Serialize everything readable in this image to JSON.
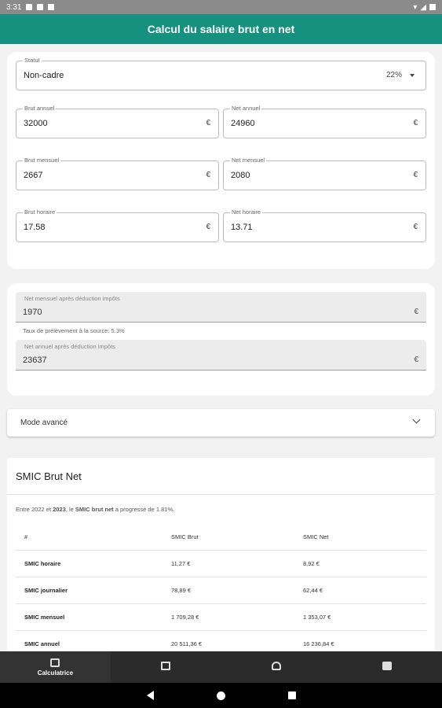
{
  "status_bar": {
    "time": "3:31"
  },
  "app_bar": {
    "title": "Calcul du salaire brut en net"
  },
  "form": {
    "statut": {
      "label": "Statut",
      "value": "Non-cadre",
      "rate": "22%"
    },
    "brut_annuel": {
      "label": "Brut annuel",
      "value": "32000",
      "unit": "€"
    },
    "net_annuel": {
      "label": "Net annuel",
      "value": "24960",
      "unit": "€"
    },
    "brut_mensuel": {
      "label": "Brut mensuel",
      "value": "2667",
      "unit": "€"
    },
    "net_mensuel": {
      "label": "Net mensuel",
      "value": "2080",
      "unit": "€"
    },
    "brut_horaire": {
      "label": "Brut horaire",
      "value": "17.58",
      "unit": "€"
    },
    "net_horaire": {
      "label": "Net horaire",
      "value": "13.71",
      "unit": "€"
    }
  },
  "taxes": {
    "net_mensuel_apres": {
      "label": "Net mensuel après déduction impôts",
      "value": "1970",
      "unit": "€"
    },
    "taux_text": "Taux de prélèvement à la source: 5.3%",
    "net_annuel_apres": {
      "label": "Net annuel après déduction impôts",
      "value": "23637",
      "unit": "€"
    }
  },
  "advanced": {
    "label": "Mode avancé"
  },
  "smic": {
    "title": "SMIC Brut Net",
    "intro_pre": "Entre 2022 et ",
    "intro_year": "2023",
    "intro_mid": ", le ",
    "intro_bold": "SMIC brut net",
    "intro_post": " a progressé de 1.81%.",
    "headers": {
      "col1": "#",
      "col2": "SMIC Brut",
      "col3": "SMIC Net"
    },
    "rows": [
      {
        "label": "SMIC horaire",
        "brut": "11,27 €",
        "net": "8,92 €"
      },
      {
        "label": "SMIC journalier",
        "brut": "78,89 €",
        "net": "62,44 €"
      },
      {
        "label": "SMIC mensuel",
        "brut": "1 709,28 €",
        "net": "1 353,07 €"
      },
      {
        "label": "SMIC annuel",
        "brut": "20 511,36 €",
        "net": "16 236,84 €"
      }
    ]
  },
  "bottom_nav": {
    "active_label": "Calculatrice"
  },
  "colors": {
    "primary": "#16917f",
    "nav_bg": "#2b2b2b"
  }
}
